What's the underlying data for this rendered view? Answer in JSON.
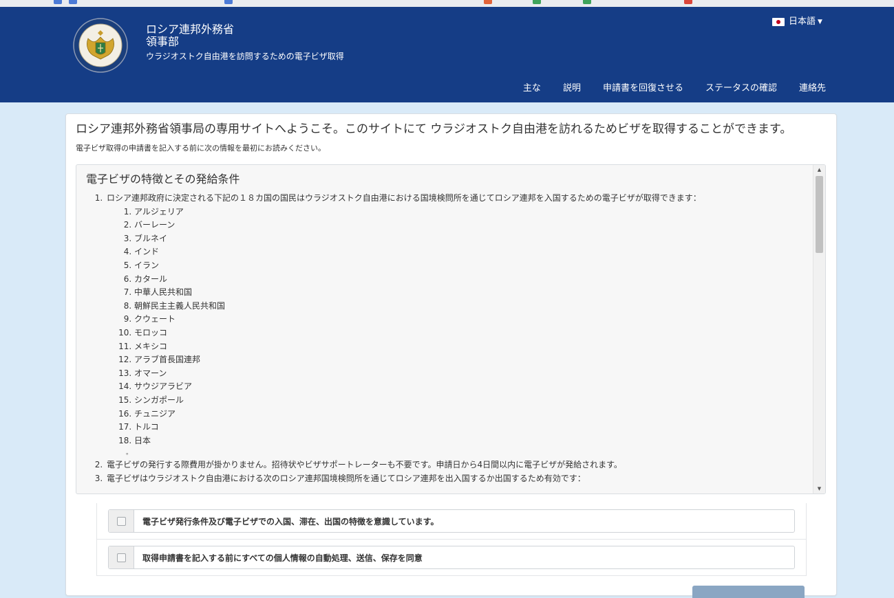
{
  "header": {
    "title": "ロシア連邦外務省",
    "subtitle": "領事部",
    "description": "ウラジオストク自由港を訪問するための電子ビザ取得",
    "language": "日本語"
  },
  "nav": {
    "items": [
      "主な",
      "説明",
      "申請書を回復させる",
      "ステータスの確認",
      "連絡先"
    ]
  },
  "main": {
    "welcome": "ロシア連邦外務省領事局の専用サイトへようこそ。このサイトにて ウラジオストク自由港を訪れるためビザを取得することができます。",
    "prompt": "電子ビザ取得の申請書を記入する前に次の情報を最初にお読みください。"
  },
  "terms": {
    "heading": "電子ビザの特徴とその発給条件",
    "items": [
      "ロシア連邦政府に決定される下記の１８カ国の国民はウラジオストク自由港における国境検問所を通じてロシア連邦を入国するための電子ビザが取得できます：",
      "電子ビザの発行する際費用が掛かりません。招待状やビザサポートレーターも不要です。申請日から4日間以内に電子ビザが発給されます。",
      "電子ビザはウラジオストク自由港における次のロシア連邦国境検問所を通じてロシア連邦を出入国するか出国するため有効です："
    ],
    "countries": [
      "アルジェリア",
      "バーレーン",
      "ブルネイ",
      "インド",
      "イラン",
      "カタール",
      "中華人民共和国",
      "朝鮮民主主義人民共和国",
      "クウェート",
      "モロッコ",
      "メキシコ",
      "アラブ首長国連邦",
      "オマーン",
      "サウジアラビア",
      "シンガポール",
      "チュニジア",
      "トルコ",
      "日本"
    ],
    "dot": "。"
  },
  "consents": [
    {
      "label": "電子ビザ発行条件及び電子ビザでの入国、滞在、出国の特徴を意識しています。",
      "checked": false
    },
    {
      "label": "取得申請書を記入する前にすべての個人情報の自動処理、送信、保存を同意",
      "checked": false
    }
  ],
  "colors": {
    "header_bg": "#153d86",
    "page_bg": "#d9eaf8",
    "flag_red": "#c0001e",
    "button": "#8aa6c3"
  },
  "icons": {
    "emblem": "mfa-emblem",
    "flag": "japan-flag-icon",
    "caret": "caret-down-icon",
    "checkbox": "checkbox-icon"
  }
}
